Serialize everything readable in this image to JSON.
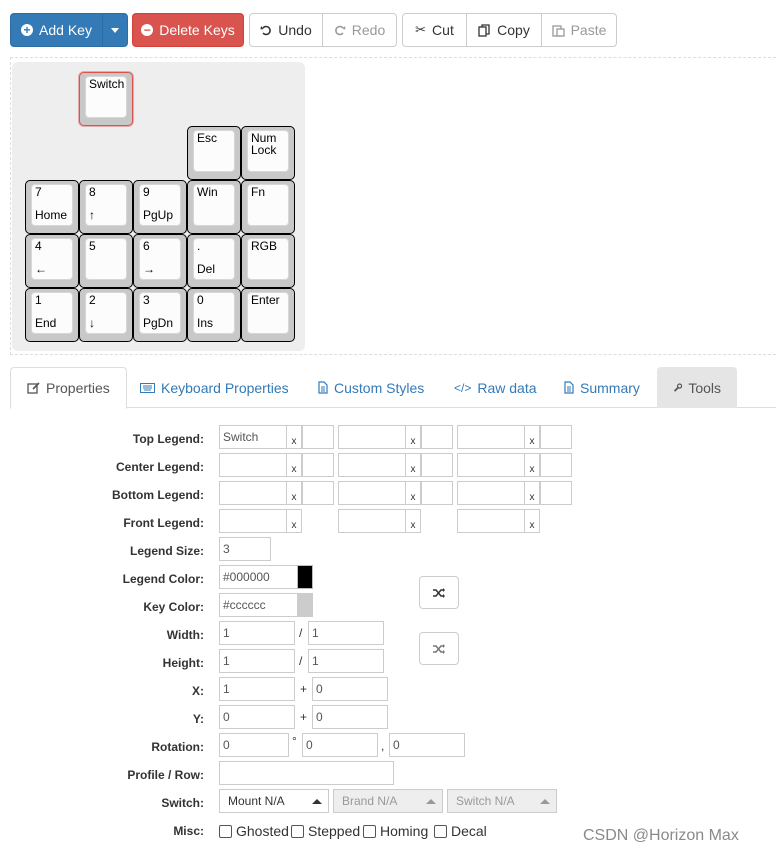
{
  "toolbar": {
    "add_key": "Add Key",
    "delete_keys": "Delete Keys",
    "undo": "Undo",
    "redo": "Redo",
    "cut": "Cut",
    "copy": "Copy",
    "paste": "Paste"
  },
  "keys": [
    {
      "top": "Switch",
      "bottom": ""
    },
    {
      "top": "Esc",
      "bottom": ""
    },
    {
      "top": "Num",
      "top2": "Lock",
      "bottom": ""
    },
    {
      "top": "7",
      "bottom": "Home"
    },
    {
      "top": "8",
      "bottom": "↑"
    },
    {
      "top": "9",
      "bottom": "PgUp"
    },
    {
      "top": "Win",
      "bottom": ""
    },
    {
      "top": "Fn",
      "bottom": ""
    },
    {
      "top": "4",
      "bottom": "←"
    },
    {
      "top": "5",
      "bottom": ""
    },
    {
      "top": "6",
      "bottom": "→"
    },
    {
      "top": ".",
      "bottom": "Del"
    },
    {
      "top": "RGB",
      "bottom": ""
    },
    {
      "top": "1",
      "bottom": "End"
    },
    {
      "top": "2",
      "bottom": "↓"
    },
    {
      "top": "3",
      "bottom": "PgDn"
    },
    {
      "top": "0",
      "bottom": "Ins"
    },
    {
      "top": "Enter",
      "bottom": ""
    }
  ],
  "tabs": {
    "properties": "Properties",
    "keyboard_properties": "Keyboard Properties",
    "custom_styles": "Custom Styles",
    "raw_data": "Raw data",
    "summary": "Summary",
    "tools": "Tools"
  },
  "form": {
    "top_legend": "Top Legend:",
    "center_legend": "Center Legend:",
    "bottom_legend": "Bottom Legend:",
    "front_legend": "Front Legend:",
    "legend_size": "Legend Size:",
    "legend_color": "Legend Color:",
    "key_color": "Key Color:",
    "width": "Width:",
    "height": "Height:",
    "x": "X:",
    "y": "Y:",
    "rotation": "Rotation:",
    "profile_row": "Profile / Row:",
    "switch": "Switch:",
    "misc": "Misc:",
    "top_legend_value": "Switch",
    "legend_size_value": "3",
    "legend_color_value": "#000000",
    "key_color_value": "#cccccc",
    "width_value": "1",
    "width2_value": "1",
    "height_value": "1",
    "height2_value": "1",
    "x_value": "1",
    "x2_value": "0",
    "y_value": "0",
    "y2_value": "0",
    "rot_value": "0",
    "rot_x_value": "0",
    "rot_y_value": "0",
    "profile_value": "",
    "mount": "Mount N/A",
    "brand": "Brand N/A",
    "switch_sel": "Switch N/A",
    "ghosted": "Ghosted",
    "stepped": "Stepped",
    "homing": "Homing",
    "decal": "Decal",
    "slash": "/",
    "plus": "+",
    "degree": "°",
    "comma": ",",
    "x_mark": "x"
  },
  "colors": {
    "legend_color": "#000000",
    "key_color": "#cccccc",
    "primary": "#337ab7",
    "danger": "#d9534f"
  },
  "watermark": "CSDN @Horizon Max"
}
